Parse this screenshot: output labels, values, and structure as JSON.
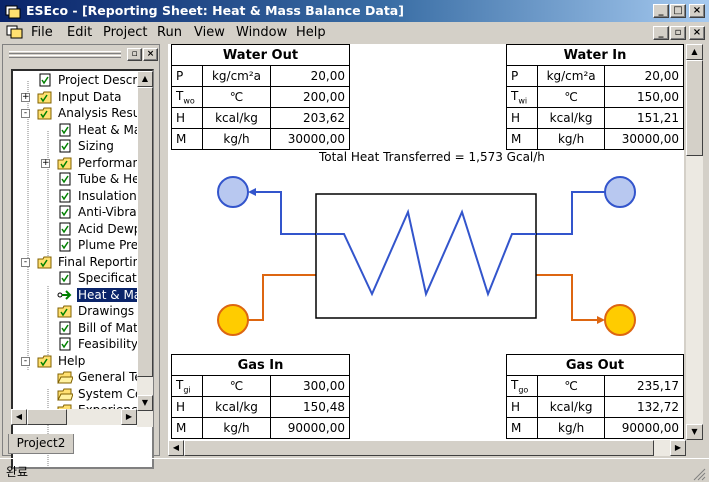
{
  "window": {
    "title": "ESEco - [Reporting Sheet: Heat & Mass Balance Data]"
  },
  "menu": [
    "File",
    "Edit",
    "Project",
    "Run",
    "View",
    "Window",
    "Help"
  ],
  "tree": {
    "items": [
      {
        "label": "Project Descri",
        "depth": 0,
        "expander": "",
        "icon": "doc-check",
        "selected": false
      },
      {
        "label": "Input Data",
        "depth": 0,
        "expander": "+",
        "icon": "folder",
        "selected": false
      },
      {
        "label": "Analysis Resu",
        "depth": 0,
        "expander": "-",
        "icon": "folder",
        "selected": false
      },
      {
        "label": "Heat & Ma",
        "depth": 1,
        "expander": "",
        "icon": "doc-check",
        "selected": false
      },
      {
        "label": "Sizing",
        "depth": 1,
        "expander": "",
        "icon": "doc-check",
        "selected": false
      },
      {
        "label": "Performan",
        "depth": 1,
        "expander": "+",
        "icon": "folder",
        "selected": false
      },
      {
        "label": "Tube & He",
        "depth": 1,
        "expander": "",
        "icon": "doc-check",
        "selected": false
      },
      {
        "label": "Insulation",
        "depth": 1,
        "expander": "",
        "icon": "doc-check",
        "selected": false
      },
      {
        "label": "Anti-Vibrat",
        "depth": 1,
        "expander": "",
        "icon": "doc-check",
        "selected": false
      },
      {
        "label": "Acid Dewp",
        "depth": 1,
        "expander": "",
        "icon": "doc-check",
        "selected": false
      },
      {
        "label": "Plume Pre",
        "depth": 1,
        "expander": "",
        "icon": "doc-check",
        "selected": false
      },
      {
        "label": "Final Reportin",
        "depth": 0,
        "expander": "-",
        "icon": "folder",
        "selected": false
      },
      {
        "label": "Specificatio",
        "depth": 1,
        "expander": "",
        "icon": "doc-check",
        "selected": false
      },
      {
        "label": "Heat & Ma",
        "depth": 1,
        "expander": "",
        "icon": "arrow",
        "selected": true
      },
      {
        "label": "Drawings",
        "depth": 1,
        "expander": "",
        "icon": "folder",
        "selected": false
      },
      {
        "label": "Bill of Mate",
        "depth": 1,
        "expander": "",
        "icon": "doc-check",
        "selected": false
      },
      {
        "label": "Feasibility",
        "depth": 1,
        "expander": "",
        "icon": "doc-check",
        "selected": false
      },
      {
        "label": "Help",
        "depth": 0,
        "expander": "-",
        "icon": "folder",
        "selected": false
      },
      {
        "label": "General Te",
        "depth": 1,
        "expander": "",
        "icon": "folder-open",
        "selected": false
      },
      {
        "label": "System Co",
        "depth": 1,
        "expander": "",
        "icon": "folder-open",
        "selected": false
      },
      {
        "label": "Experience",
        "depth": 1,
        "expander": "",
        "icon": "folder-open",
        "selected": false
      }
    ],
    "tab_label": "Project2"
  },
  "tables": {
    "water_out": {
      "title": "Water Out",
      "rows": [
        {
          "sym": "P",
          "sub": "",
          "unit": "kg/cm²a",
          "value": "20,00"
        },
        {
          "sym": "T",
          "sub": "wo",
          "unit": "℃",
          "value": "200,00"
        },
        {
          "sym": "H",
          "sub": "",
          "unit": "kcal/kg",
          "value": "203,62"
        },
        {
          "sym": "M",
          "sub": "",
          "unit": "kg/h",
          "value": "30000,00"
        }
      ]
    },
    "water_in": {
      "title": "Water In",
      "rows": [
        {
          "sym": "P",
          "sub": "",
          "unit": "kg/cm²a",
          "value": "20,00"
        },
        {
          "sym": "T",
          "sub": "wi",
          "unit": "℃",
          "value": "150,00"
        },
        {
          "sym": "H",
          "sub": "",
          "unit": "kcal/kg",
          "value": "151,21"
        },
        {
          "sym": "M",
          "sub": "",
          "unit": "kg/h",
          "value": "30000,00"
        }
      ]
    },
    "gas_in": {
      "title": "Gas In",
      "rows": [
        {
          "sym": "T",
          "sub": "gi",
          "unit": "℃",
          "value": "300,00"
        },
        {
          "sym": "H",
          "sub": "",
          "unit": "kcal/kg",
          "value": "150,48"
        },
        {
          "sym": "M",
          "sub": "",
          "unit": "kg/h",
          "value": "90000,00"
        }
      ]
    },
    "gas_out": {
      "title": "Gas Out",
      "rows": [
        {
          "sym": "T",
          "sub": "go",
          "unit": "℃",
          "value": "235,17"
        },
        {
          "sym": "H",
          "sub": "",
          "unit": "kcal/kg",
          "value": "132,72"
        },
        {
          "sym": "M",
          "sub": "",
          "unit": "kg/h",
          "value": "90000,00"
        }
      ]
    }
  },
  "total_heat": "Total Heat Transferred = 1,573 Gcal/h",
  "status": "완료",
  "colors": {
    "water_line": "#3355cc",
    "water_circle": "#b8c8f0",
    "gas_line": "#dd6611",
    "gas_circle": "#ffcc00"
  }
}
